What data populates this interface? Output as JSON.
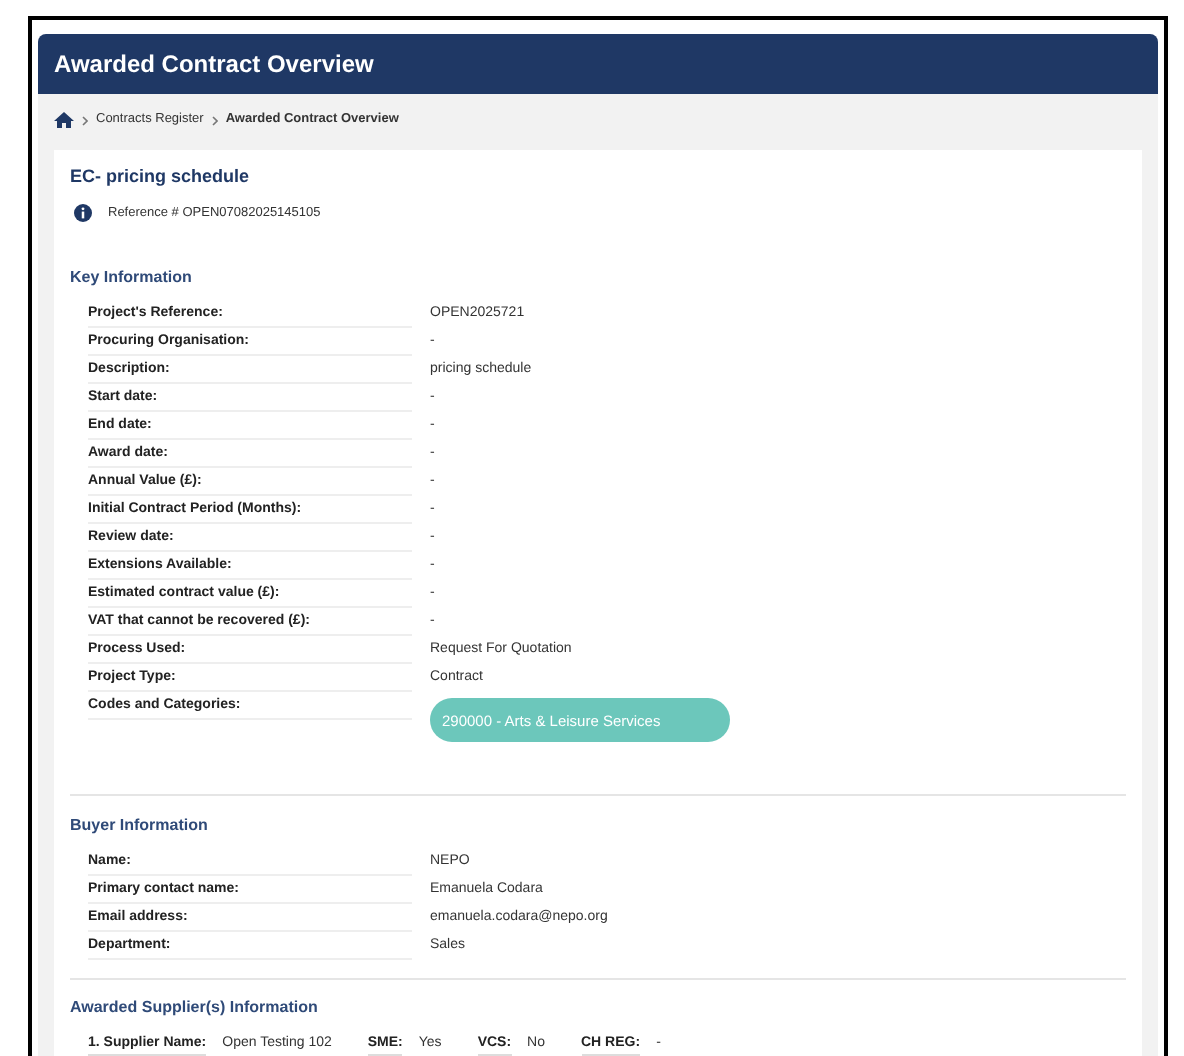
{
  "header": {
    "title": "Awarded Contract Overview"
  },
  "breadcrumb": [
    "Contracts Register",
    "Awarded Contract Overview"
  ],
  "contract": {
    "title": "EC- pricing schedule",
    "reference": "Reference # OPEN07082025145105"
  },
  "key_information": {
    "heading": "Key Information",
    "rows": [
      {
        "label": "Project's Reference:",
        "value": "OPEN2025721"
      },
      {
        "label": "Procuring Organisation:",
        "value": "-"
      },
      {
        "label": "Description:",
        "value": "pricing schedule"
      },
      {
        "label": "Start date:",
        "value": "-"
      },
      {
        "label": "End date:",
        "value": "-"
      },
      {
        "label": "Award date:",
        "value": "-"
      },
      {
        "label": "Annual Value (£):",
        "value": "-"
      },
      {
        "label": "Initial Contract Period (Months):",
        "value": "-"
      },
      {
        "label": "Review date:",
        "value": "-"
      },
      {
        "label": "Extensions Available:",
        "value": "-"
      },
      {
        "label": "Estimated contract value (£):",
        "value": "-"
      },
      {
        "label": "VAT that cannot be recovered (£):",
        "value": "-"
      },
      {
        "label": "Process Used:",
        "value": "Request For Quotation"
      },
      {
        "label": "Project Type:",
        "value": "Contract"
      },
      {
        "label": "Codes and Categories:",
        "tags": [
          "290000 - Arts & Leisure Services"
        ]
      }
    ]
  },
  "buyer_information": {
    "heading": "Buyer Information",
    "rows": [
      {
        "label": "Name:",
        "value": "NEPO"
      },
      {
        "label": "Primary contact name:",
        "value": "Emanuela Codara"
      },
      {
        "label": "Email address:",
        "value": "emanuela.codara@nepo.org"
      },
      {
        "label": "Department:",
        "value": "Sales"
      }
    ]
  },
  "suppliers": {
    "heading": "Awarded Supplier(s) Information",
    "items": [
      {
        "fields": [
          {
            "label": "1. Supplier Name:",
            "value": "Open Testing 102"
          },
          {
            "label": "SME:",
            "value": "Yes"
          },
          {
            "label": "VCS:",
            "value": "No"
          },
          {
            "label": "CH REG:",
            "value": "-"
          }
        ]
      }
    ]
  }
}
